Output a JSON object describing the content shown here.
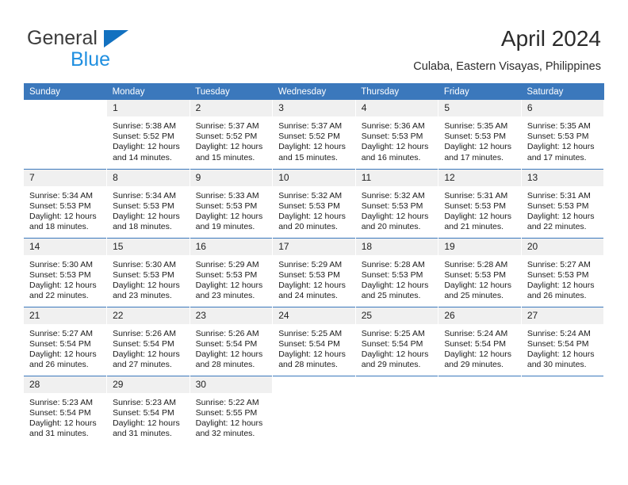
{
  "brand": {
    "line1": "General",
    "line2": "Blue",
    "triangle_color": "#1271c0",
    "line2_color": "#1f8fe0"
  },
  "header": {
    "title": "April 2024",
    "subtitle": "Culaba, Eastern Visayas, Philippines",
    "accent_color": "#3b78bc"
  },
  "calendar": {
    "weekday_headers": [
      "Sunday",
      "Monday",
      "Tuesday",
      "Wednesday",
      "Thursday",
      "Friday",
      "Saturday"
    ],
    "weeks": [
      [
        {
          "day": "",
          "sunrise": "",
          "sunset": "",
          "daylight_line1": "",
          "daylight_line2": "",
          "empty": true
        },
        {
          "day": "1",
          "sunrise": "Sunrise: 5:38 AM",
          "sunset": "Sunset: 5:52 PM",
          "daylight_line1": "Daylight: 12 hours",
          "daylight_line2": "and 14 minutes.",
          "empty": false
        },
        {
          "day": "2",
          "sunrise": "Sunrise: 5:37 AM",
          "sunset": "Sunset: 5:52 PM",
          "daylight_line1": "Daylight: 12 hours",
          "daylight_line2": "and 15 minutes.",
          "empty": false
        },
        {
          "day": "3",
          "sunrise": "Sunrise: 5:37 AM",
          "sunset": "Sunset: 5:52 PM",
          "daylight_line1": "Daylight: 12 hours",
          "daylight_line2": "and 15 minutes.",
          "empty": false
        },
        {
          "day": "4",
          "sunrise": "Sunrise: 5:36 AM",
          "sunset": "Sunset: 5:53 PM",
          "daylight_line1": "Daylight: 12 hours",
          "daylight_line2": "and 16 minutes.",
          "empty": false
        },
        {
          "day": "5",
          "sunrise": "Sunrise: 5:35 AM",
          "sunset": "Sunset: 5:53 PM",
          "daylight_line1": "Daylight: 12 hours",
          "daylight_line2": "and 17 minutes.",
          "empty": false
        },
        {
          "day": "6",
          "sunrise": "Sunrise: 5:35 AM",
          "sunset": "Sunset: 5:53 PM",
          "daylight_line1": "Daylight: 12 hours",
          "daylight_line2": "and 17 minutes.",
          "empty": false
        }
      ],
      [
        {
          "day": "7",
          "sunrise": "Sunrise: 5:34 AM",
          "sunset": "Sunset: 5:53 PM",
          "daylight_line1": "Daylight: 12 hours",
          "daylight_line2": "and 18 minutes.",
          "empty": false
        },
        {
          "day": "8",
          "sunrise": "Sunrise: 5:34 AM",
          "sunset": "Sunset: 5:53 PM",
          "daylight_line1": "Daylight: 12 hours",
          "daylight_line2": "and 18 minutes.",
          "empty": false
        },
        {
          "day": "9",
          "sunrise": "Sunrise: 5:33 AM",
          "sunset": "Sunset: 5:53 PM",
          "daylight_line1": "Daylight: 12 hours",
          "daylight_line2": "and 19 minutes.",
          "empty": false
        },
        {
          "day": "10",
          "sunrise": "Sunrise: 5:32 AM",
          "sunset": "Sunset: 5:53 PM",
          "daylight_line1": "Daylight: 12 hours",
          "daylight_line2": "and 20 minutes.",
          "empty": false
        },
        {
          "day": "11",
          "sunrise": "Sunrise: 5:32 AM",
          "sunset": "Sunset: 5:53 PM",
          "daylight_line1": "Daylight: 12 hours",
          "daylight_line2": "and 20 minutes.",
          "empty": false
        },
        {
          "day": "12",
          "sunrise": "Sunrise: 5:31 AM",
          "sunset": "Sunset: 5:53 PM",
          "daylight_line1": "Daylight: 12 hours",
          "daylight_line2": "and 21 minutes.",
          "empty": false
        },
        {
          "day": "13",
          "sunrise": "Sunrise: 5:31 AM",
          "sunset": "Sunset: 5:53 PM",
          "daylight_line1": "Daylight: 12 hours",
          "daylight_line2": "and 22 minutes.",
          "empty": false
        }
      ],
      [
        {
          "day": "14",
          "sunrise": "Sunrise: 5:30 AM",
          "sunset": "Sunset: 5:53 PM",
          "daylight_line1": "Daylight: 12 hours",
          "daylight_line2": "and 22 minutes.",
          "empty": false
        },
        {
          "day": "15",
          "sunrise": "Sunrise: 5:30 AM",
          "sunset": "Sunset: 5:53 PM",
          "daylight_line1": "Daylight: 12 hours",
          "daylight_line2": "and 23 minutes.",
          "empty": false
        },
        {
          "day": "16",
          "sunrise": "Sunrise: 5:29 AM",
          "sunset": "Sunset: 5:53 PM",
          "daylight_line1": "Daylight: 12 hours",
          "daylight_line2": "and 23 minutes.",
          "empty": false
        },
        {
          "day": "17",
          "sunrise": "Sunrise: 5:29 AM",
          "sunset": "Sunset: 5:53 PM",
          "daylight_line1": "Daylight: 12 hours",
          "daylight_line2": "and 24 minutes.",
          "empty": false
        },
        {
          "day": "18",
          "sunrise": "Sunrise: 5:28 AM",
          "sunset": "Sunset: 5:53 PM",
          "daylight_line1": "Daylight: 12 hours",
          "daylight_line2": "and 25 minutes.",
          "empty": false
        },
        {
          "day": "19",
          "sunrise": "Sunrise: 5:28 AM",
          "sunset": "Sunset: 5:53 PM",
          "daylight_line1": "Daylight: 12 hours",
          "daylight_line2": "and 25 minutes.",
          "empty": false
        },
        {
          "day": "20",
          "sunrise": "Sunrise: 5:27 AM",
          "sunset": "Sunset: 5:53 PM",
          "daylight_line1": "Daylight: 12 hours",
          "daylight_line2": "and 26 minutes.",
          "empty": false
        }
      ],
      [
        {
          "day": "21",
          "sunrise": "Sunrise: 5:27 AM",
          "sunset": "Sunset: 5:54 PM",
          "daylight_line1": "Daylight: 12 hours",
          "daylight_line2": "and 26 minutes.",
          "empty": false
        },
        {
          "day": "22",
          "sunrise": "Sunrise: 5:26 AM",
          "sunset": "Sunset: 5:54 PM",
          "daylight_line1": "Daylight: 12 hours",
          "daylight_line2": "and 27 minutes.",
          "empty": false
        },
        {
          "day": "23",
          "sunrise": "Sunrise: 5:26 AM",
          "sunset": "Sunset: 5:54 PM",
          "daylight_line1": "Daylight: 12 hours",
          "daylight_line2": "and 28 minutes.",
          "empty": false
        },
        {
          "day": "24",
          "sunrise": "Sunrise: 5:25 AM",
          "sunset": "Sunset: 5:54 PM",
          "daylight_line1": "Daylight: 12 hours",
          "daylight_line2": "and 28 minutes.",
          "empty": false
        },
        {
          "day": "25",
          "sunrise": "Sunrise: 5:25 AM",
          "sunset": "Sunset: 5:54 PM",
          "daylight_line1": "Daylight: 12 hours",
          "daylight_line2": "and 29 minutes.",
          "empty": false
        },
        {
          "day": "26",
          "sunrise": "Sunrise: 5:24 AM",
          "sunset": "Sunset: 5:54 PM",
          "daylight_line1": "Daylight: 12 hours",
          "daylight_line2": "and 29 minutes.",
          "empty": false
        },
        {
          "day": "27",
          "sunrise": "Sunrise: 5:24 AM",
          "sunset": "Sunset: 5:54 PM",
          "daylight_line1": "Daylight: 12 hours",
          "daylight_line2": "and 30 minutes.",
          "empty": false
        }
      ],
      [
        {
          "day": "28",
          "sunrise": "Sunrise: 5:23 AM",
          "sunset": "Sunset: 5:54 PM",
          "daylight_line1": "Daylight: 12 hours",
          "daylight_line2": "and 31 minutes.",
          "empty": false
        },
        {
          "day": "29",
          "sunrise": "Sunrise: 5:23 AM",
          "sunset": "Sunset: 5:54 PM",
          "daylight_line1": "Daylight: 12 hours",
          "daylight_line2": "and 31 minutes.",
          "empty": false
        },
        {
          "day": "30",
          "sunrise": "Sunrise: 5:22 AM",
          "sunset": "Sunset: 5:55 PM",
          "daylight_line1": "Daylight: 12 hours",
          "daylight_line2": "and 32 minutes.",
          "empty": false
        },
        {
          "day": "",
          "sunrise": "",
          "sunset": "",
          "daylight_line1": "",
          "daylight_line2": "",
          "empty": true
        },
        {
          "day": "",
          "sunrise": "",
          "sunset": "",
          "daylight_line1": "",
          "daylight_line2": "",
          "empty": true
        },
        {
          "day": "",
          "sunrise": "",
          "sunset": "",
          "daylight_line1": "",
          "daylight_line2": "",
          "empty": true
        },
        {
          "day": "",
          "sunrise": "",
          "sunset": "",
          "daylight_line1": "",
          "daylight_line2": "",
          "empty": true
        }
      ]
    ]
  }
}
